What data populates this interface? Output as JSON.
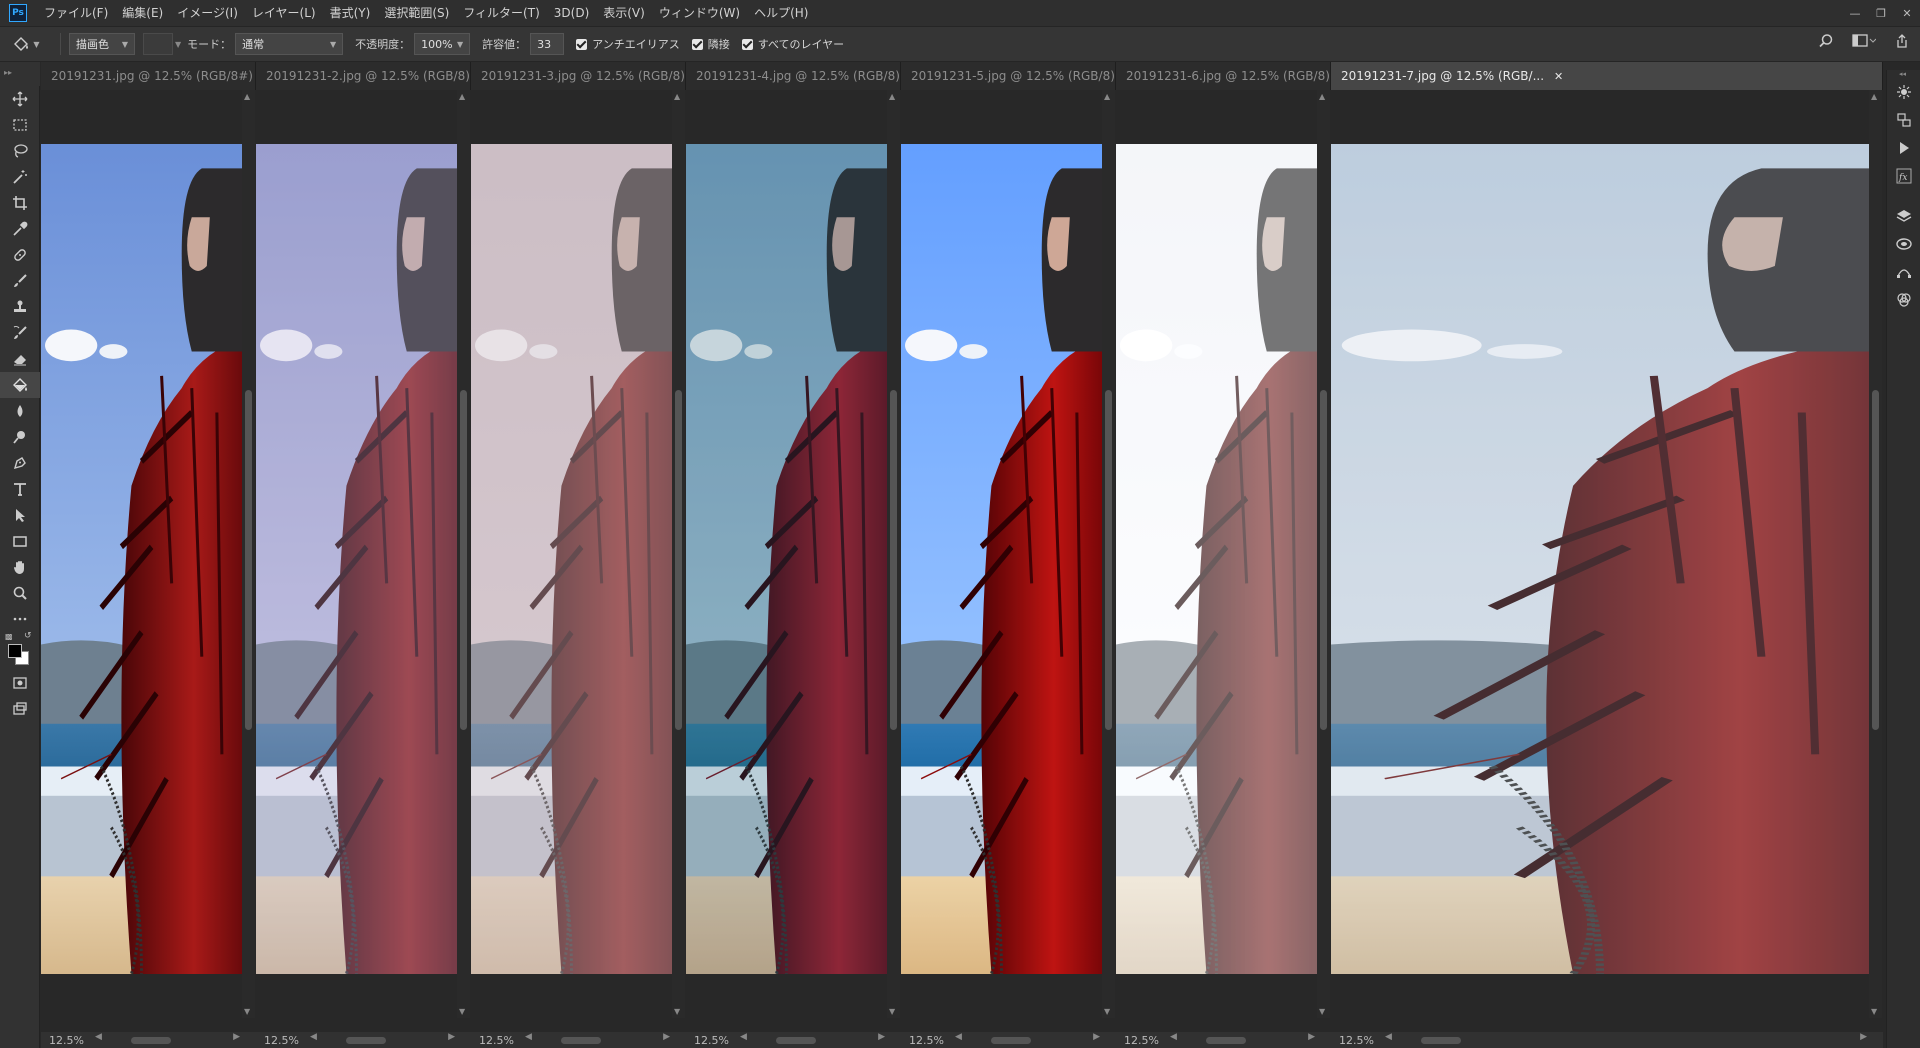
{
  "app": {
    "logo": "Ps",
    "menus": [
      "ファイル(F)",
      "編集(E)",
      "イメージ(I)",
      "レイヤー(L)",
      "書式(Y)",
      "選択範囲(S)",
      "フィルター(T)",
      "3D(D)",
      "表示(V)",
      "ウィンドウ(W)",
      "ヘルプ(H)"
    ]
  },
  "options": {
    "fill_source": "描画色",
    "mode_label": "モード：",
    "mode_value": "通常",
    "opacity_label": "不透明度：",
    "opacity_value": "100%",
    "tolerance_label": "許容値：",
    "tolerance_value": "33",
    "antialias_label": "アンチエイリアス",
    "contiguous_label": "隣接",
    "all_layers_label": "すべてのレイヤー"
  },
  "documents": [
    {
      "tab": "20191231.jpg @ 12.5% (RGB/8#)",
      "zoom": "12.5%",
      "active": false,
      "tint": "original"
    },
    {
      "tab": "20191231-2.jpg @ 12.5% (RGB/8)",
      "zoom": "12.5%",
      "active": false,
      "tint": "lavender"
    },
    {
      "tab": "20191231-3.jpg @ 12.5% (RGB/8)",
      "zoom": "12.5%",
      "active": false,
      "tint": "pink"
    },
    {
      "tab": "20191231-4.jpg @ 12.5% (RGB/8)",
      "zoom": "12.5%",
      "active": false,
      "tint": "teal"
    },
    {
      "tab": "20191231-5.jpg @ 12.5% (RGB/8)",
      "zoom": "12.5%",
      "active": false,
      "tint": "vivid"
    },
    {
      "tab": "20191231-6.jpg @ 12.5% (RGB/8)",
      "zoom": "12.5%",
      "active": false,
      "tint": "white"
    },
    {
      "tab": "20191231-7.jpg @ 12.5% (RGB/...",
      "zoom": "12.5%",
      "active": true,
      "tint": "cool"
    }
  ],
  "tools": [
    "move-icon",
    "marquee-icon",
    "lasso-icon",
    "magic-wand-icon",
    "crop-icon",
    "eyedropper-icon",
    "healing-brush-icon",
    "brush-icon",
    "clone-stamp-icon",
    "history-brush-icon",
    "eraser-icon",
    "paint-bucket-icon",
    "blur-icon",
    "dodge-icon",
    "pen-icon",
    "type-icon",
    "path-selection-icon",
    "rectangle-icon",
    "hand-icon",
    "zoom-icon",
    "more-tools-icon"
  ],
  "colors": {
    "foreground": "#000000",
    "background": "#ffffff",
    "accent": "#31a8ff"
  }
}
